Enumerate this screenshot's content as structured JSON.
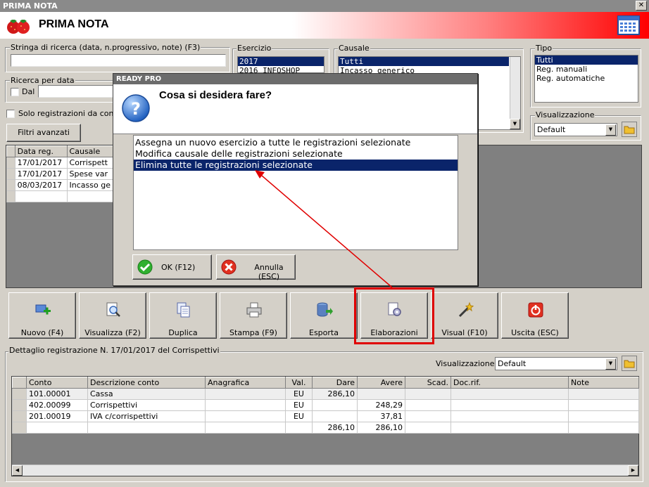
{
  "window": {
    "title": "PRIMA NOTA",
    "header_title": "PRIMA NOTA",
    "close_label": "✕"
  },
  "search": {
    "label": "Stringa di ricerca (data, n.progressivo, note) (F3)",
    "value": ""
  },
  "date_search": {
    "label": "Ricerca per data",
    "from_label": "Dal",
    "checked": false
  },
  "controlled_only": {
    "label": "Solo registrazioni da controll",
    "checked": false
  },
  "advanced_filters_label": "Filtri avanzati",
  "esercizio": {
    "label": "Esercizio",
    "items": [
      "2017",
      "2016 INFOSHOP"
    ],
    "selected": 0
  },
  "causale": {
    "label": "Causale",
    "items": [
      "Tutti",
      "Incasso generico"
    ],
    "selected": 0
  },
  "tipo": {
    "label": "Tipo",
    "items": [
      "Tutti",
      "Reg. manuali",
      "Reg. automatiche"
    ],
    "selected": 0
  },
  "top_view": {
    "label": "Visualizzazione",
    "value": "Default"
  },
  "reg_grid": {
    "headers": [
      "Data reg.",
      "Causale"
    ],
    "rows": [
      [
        "17/01/2017",
        "Corrispett"
      ],
      [
        "17/01/2017",
        "Spese var"
      ],
      [
        "08/03/2017",
        "Incasso ge"
      ]
    ]
  },
  "dialog": {
    "title": "READY PRO",
    "question": "Cosa si desidera fare?",
    "options": [
      "Assegna un nuovo esercizio a tutte le registrazioni selezionate",
      "Modifica causale delle registrazioni selezionate",
      "Elimina tutte le registrazioni selezionate"
    ],
    "selected": 2,
    "ok_label": "OK (F12)",
    "cancel_label": "Annulla (ESC)"
  },
  "toolbar": {
    "buttons": [
      {
        "label": "Nuovo (F4)",
        "icon": "new-record-icon"
      },
      {
        "label": "Visualizza (F2)",
        "icon": "view-document-icon"
      },
      {
        "label": "Duplica",
        "icon": "duplicate-icon"
      },
      {
        "label": "Stampa (F9)",
        "icon": "printer-icon"
      },
      {
        "label": "Esporta",
        "icon": "database-export-icon"
      },
      {
        "label": "Elaborazioni",
        "icon": "processing-gear-icon"
      },
      {
        "label": "Visual (F10)",
        "icon": "magic-wand-icon"
      },
      {
        "label": "Uscita (ESC)",
        "icon": "exit-icon"
      }
    ]
  },
  "detail": {
    "label": "Dettaglio registrazione N. 17/01/2017 del Corrispettivi",
    "view_label": "Visualizzazione :",
    "view_value": "Default",
    "headers": [
      "Conto",
      "Descrizione conto",
      "Anagrafica",
      "Val.",
      "Dare",
      "Avere",
      "Scad.",
      "Doc.rif.",
      "Note"
    ],
    "rows": [
      [
        "101.00001",
        "Cassa",
        "",
        "EU",
        "286,10",
        "",
        "",
        "",
        ""
      ],
      [
        "402.00099",
        "Corrispettivi",
        "",
        "EU",
        "",
        "248,29",
        "",
        "",
        ""
      ],
      [
        "201.00019",
        "IVA c/corrispettivi",
        "",
        "EU",
        "",
        "37,81",
        "",
        "",
        ""
      ]
    ],
    "totals": {
      "dare": "286,10",
      "avere": "286,10"
    }
  },
  "colors": {
    "highlight": "#e00000",
    "selection": "#0a246a"
  }
}
